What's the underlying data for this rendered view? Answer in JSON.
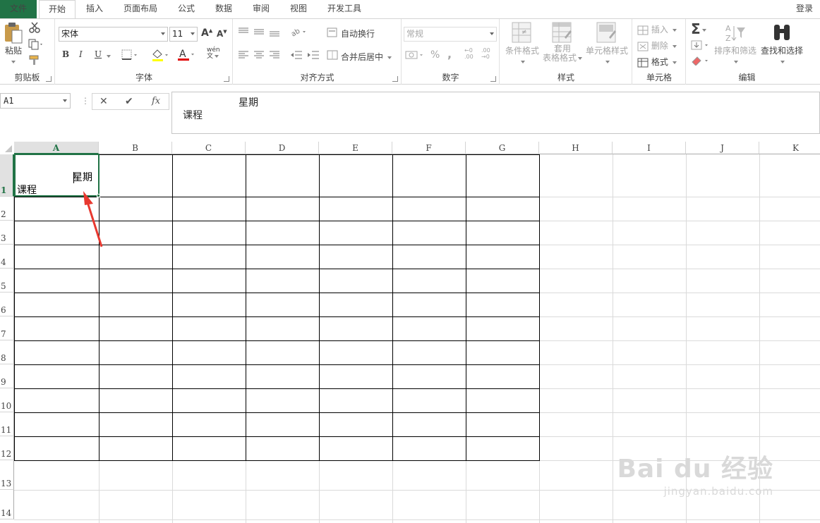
{
  "tabs": [
    "文件",
    "开始",
    "插入",
    "页面布局",
    "公式",
    "数据",
    "审阅",
    "视图",
    "开发工具"
  ],
  "account": "登录",
  "ribbon": {
    "clipboard": {
      "label": "剪贴板",
      "paste": "粘贴"
    },
    "font": {
      "label": "字体",
      "name": "宋体",
      "size": "11",
      "bold": "B",
      "italic": "I",
      "underline": "U",
      "grow": "A",
      "shrink": "A",
      "color_letter": "A",
      "phonetic": "wén"
    },
    "alignment": {
      "label": "对齐方式",
      "wrap": "自动换行",
      "merge": "合并后居中"
    },
    "number": {
      "label": "数字",
      "format": "常规",
      "percent": "%",
      "comma": ",",
      "inc_decimal": "←0 .00",
      "dec_decimal": ".00 →0"
    },
    "styles": {
      "label": "样式",
      "conditional": "条件格式",
      "table_line1": "套用",
      "table_line2": "表格格式",
      "cell_styles": "单元格样式"
    },
    "cells": {
      "label": "单元格",
      "insert": "插入",
      "delete": "删除",
      "format": "格式"
    },
    "editing": {
      "label": "编辑",
      "sum": "Σ",
      "sort": "排序和筛选",
      "find": "查找和选择"
    }
  },
  "formula_bar": {
    "name_box": "A1",
    "cancel": "✕",
    "enter": "✔",
    "fx": "fx",
    "content_line1": "星期",
    "content_line2": "课程"
  },
  "sheet": {
    "columns": [
      "A",
      "B",
      "C",
      "D",
      "E",
      "F",
      "G",
      "H",
      "I",
      "J",
      "K"
    ],
    "rows": [
      "1",
      "2",
      "3",
      "4",
      "5",
      "6",
      "7",
      "8",
      "9",
      "10",
      "11",
      "12",
      "13",
      "14"
    ],
    "a1_top": "星期",
    "a1_bottom": "课程",
    "selected_cell": "A1",
    "selected_column": "A",
    "selected_row": "1"
  },
  "watermark": {
    "brand": "Bai du 经验",
    "url": "jingyan.baidu.com"
  },
  "colors": {
    "excel_green": "#217346",
    "annotation_arrow": "#e8382f"
  }
}
